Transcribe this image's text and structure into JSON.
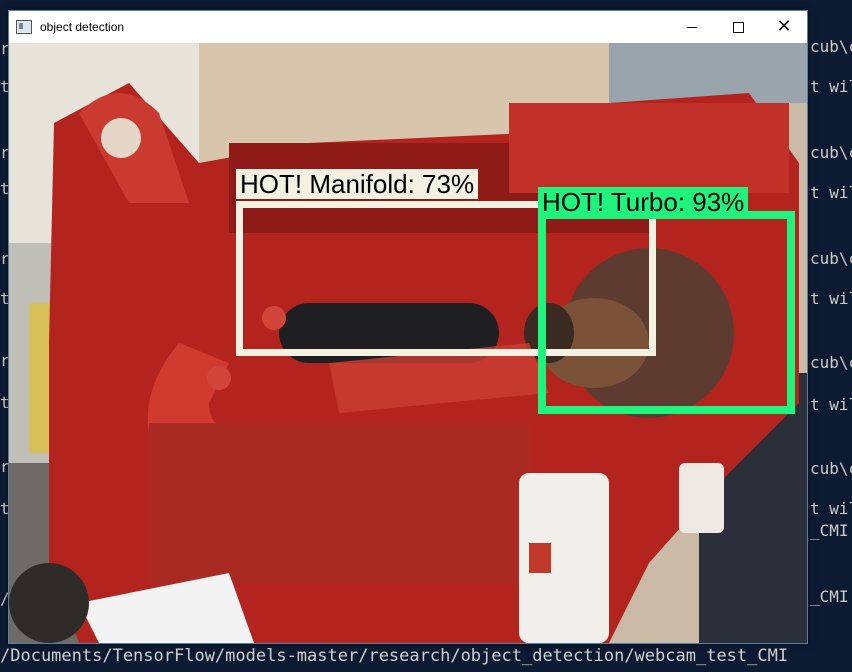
{
  "window": {
    "title": "object detection",
    "controls": {
      "minimize": "minimize",
      "maximize": "maximize",
      "close": "close"
    }
  },
  "detections": [
    {
      "label": "HOT! Manifold: 73%",
      "color": "#f3f1e2"
    },
    {
      "label": "HOT! Turbo: 93%",
      "color": "#1ff57c"
    }
  ],
  "console": {
    "bottom_line": "/Documents/TensorFlow/models-master/research/object_detection/webcam_test_CMI",
    "right_fragments": [
      "cub\\c",
      "t wil",
      "cub\\c",
      "t wil",
      "cub\\c",
      "t wil",
      "cub\\c",
      "t wil",
      "cub\\c",
      "t wil",
      "_CMI.",
      "_CMI."
    ]
  }
}
